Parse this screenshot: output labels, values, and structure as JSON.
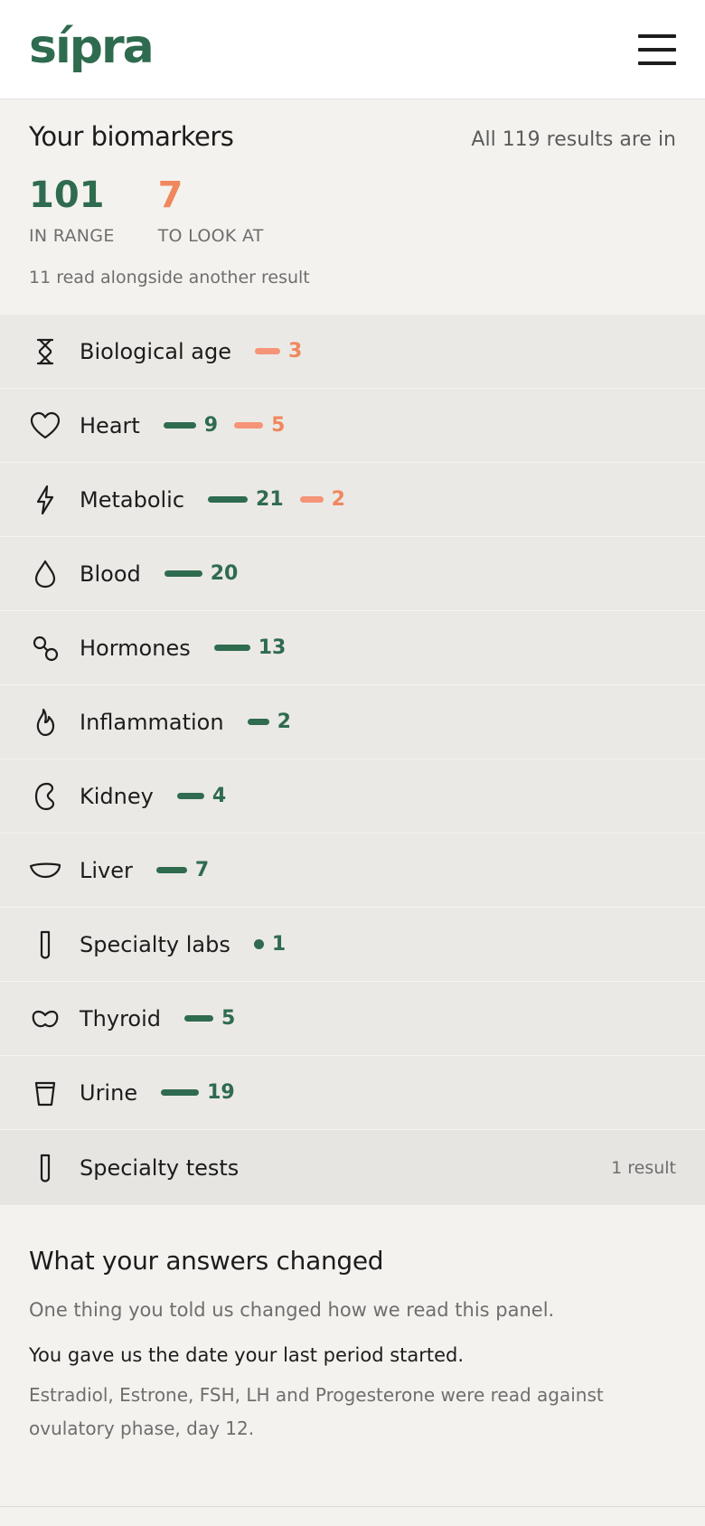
{
  "header": {
    "logo": "sípra"
  },
  "summary": {
    "title": "Your biomarkers",
    "status": "All 119 results are in",
    "in_range_count": "101",
    "in_range_label": "IN RANGE",
    "look_at_count": "7",
    "look_at_label": "TO LOOK AT",
    "note": "11 read alongside another result"
  },
  "categories": [
    {
      "label": "Biological age",
      "icon": "hourglass-icon",
      "stats": [
        {
          "type": "orange",
          "value": "3"
        }
      ]
    },
    {
      "label": "Heart",
      "icon": "heart-icon",
      "stats": [
        {
          "type": "green",
          "value": "9"
        },
        {
          "type": "orange",
          "value": "5"
        }
      ]
    },
    {
      "label": "Metabolic",
      "icon": "lightning-icon",
      "stats": [
        {
          "type": "green",
          "value": "21"
        },
        {
          "type": "orange",
          "value": "2"
        }
      ]
    },
    {
      "label": "Blood",
      "icon": "drop-icon",
      "stats": [
        {
          "type": "green",
          "value": "20"
        }
      ]
    },
    {
      "label": "Hormones",
      "icon": "hormones-icon",
      "stats": [
        {
          "type": "green",
          "value": "13"
        }
      ]
    },
    {
      "label": "Inflammation",
      "icon": "flame-icon",
      "stats": [
        {
          "type": "green",
          "value": "2"
        }
      ]
    },
    {
      "label": "Kidney",
      "icon": "kidney-icon",
      "stats": [
        {
          "type": "green",
          "value": "4"
        }
      ]
    },
    {
      "label": "Liver",
      "icon": "liver-icon",
      "stats": [
        {
          "type": "green",
          "value": "7"
        }
      ]
    },
    {
      "label": "Specialty labs",
      "icon": "test-tube-icon",
      "stats": [
        {
          "type": "green",
          "value": "1"
        }
      ]
    },
    {
      "label": "Thyroid",
      "icon": "thyroid-icon",
      "stats": [
        {
          "type": "green",
          "value": "5"
        }
      ]
    },
    {
      "label": "Urine",
      "icon": "cup-icon",
      "stats": [
        {
          "type": "green",
          "value": "19"
        }
      ]
    }
  ],
  "specialty_tests": {
    "label": "Specialty tests",
    "icon": "test-tube-icon",
    "right_text": "1 result"
  },
  "answers": {
    "title": "What your answers changed",
    "subtitle": "One thing you told us changed how we read this panel.",
    "bold": "You gave us the date your last period started.",
    "detail": "Estradiol, Estrone, FSH, LH and Progesterone were read against ovulatory phase, day 12."
  },
  "colors": {
    "green": "#2f6b4f",
    "orange": "#f0875f",
    "background": "#f4f2ee",
    "row": "#ebe9e5"
  }
}
